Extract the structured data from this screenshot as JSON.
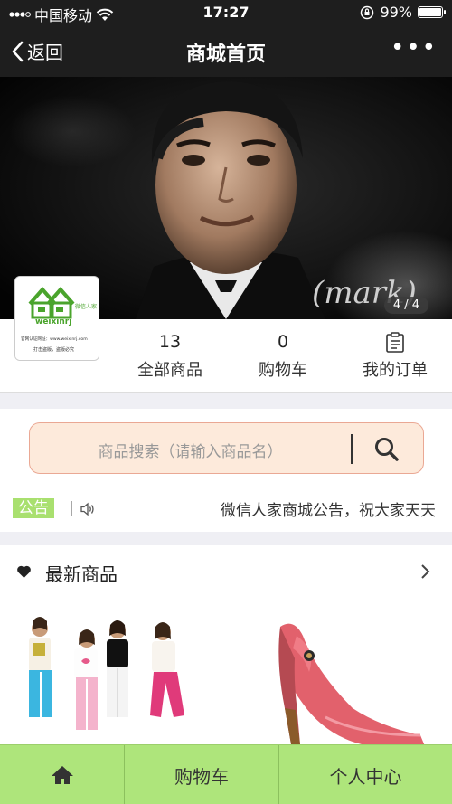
{
  "status_bar": {
    "carrier": "中国移动",
    "time": "17:27",
    "battery": "99%",
    "battery_level": 0.99
  },
  "nav": {
    "back_label": "返回",
    "title": "商城首页",
    "more": "•••"
  },
  "banner": {
    "counter": "4 / 4"
  },
  "store_logo": {
    "brand_cn": "微信人家",
    "brand_en": "weixinrj",
    "line1": "官网认证网址：www.weixinrj.com",
    "line2": "打击盗版，盗版必究"
  },
  "stats": [
    {
      "count": "13",
      "label": "全部商品"
    },
    {
      "count": "0",
      "label": "购物车"
    },
    {
      "count": "",
      "label": "我的订单"
    }
  ],
  "search": {
    "placeholder": "商品搜索（请输入商品名）"
  },
  "notice": {
    "badge": "公告",
    "separator": "|",
    "text": "微信人家商城公告，祝大家天天"
  },
  "new_products": {
    "title": "最新商品"
  },
  "tabbar": {
    "cart": "购物车",
    "profile": "个人中心"
  },
  "colors": {
    "tabbar": "#aee57b",
    "notice_badge": "#a9e06f",
    "search_bg": "#fdeadb",
    "nav_bg": "#1e1e1e"
  }
}
